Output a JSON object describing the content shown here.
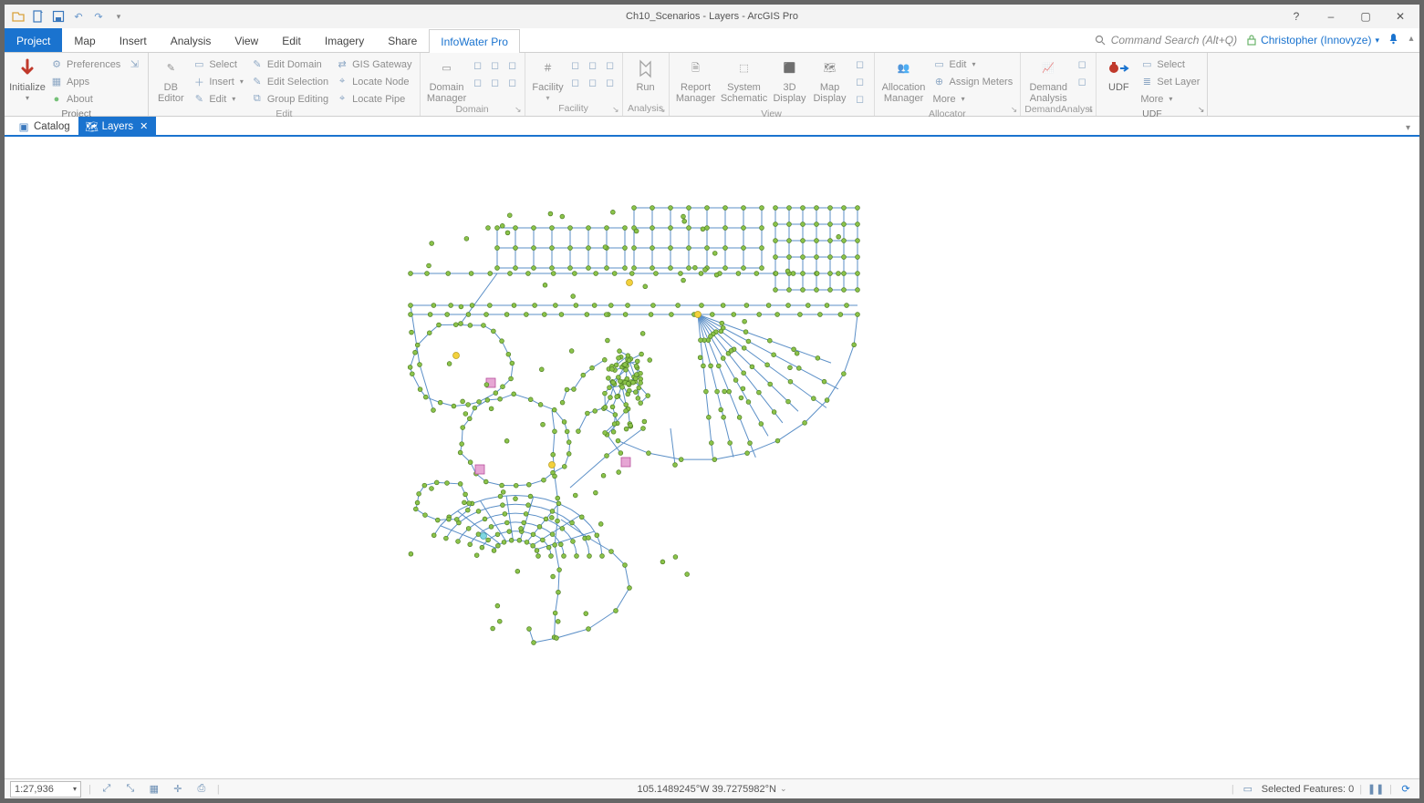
{
  "title": "Ch10_Scenarios - Layers - ArcGIS Pro",
  "qat": {
    "tips": [
      "open",
      "new",
      "save",
      "undo",
      "redo",
      "customize"
    ]
  },
  "sys": {
    "help": "?",
    "min": "–",
    "max": "▢",
    "close": "✕"
  },
  "search": {
    "placeholder": "Command Search (Alt+Q)"
  },
  "user": {
    "name": "Christopher (Innovyze)"
  },
  "tabs": {
    "project": "Project",
    "items": [
      "Map",
      "Insert",
      "Analysis",
      "View",
      "Edit",
      "Imagery",
      "Share",
      "InfoWater Pro"
    ],
    "active": "InfoWater Pro"
  },
  "ribbon": {
    "project": {
      "label": "Project",
      "initialize": "Initialize",
      "preferences": "Preferences",
      "apps": "Apps",
      "about": "About"
    },
    "edit": {
      "label": "Edit",
      "dbeditor": "DB\nEditor",
      "select": "Select",
      "insert": "Insert",
      "edit": "Edit",
      "editdomain": "Edit Domain",
      "editselection": "Edit Selection",
      "groupediting": "Group Editing",
      "gisgateway": "GIS Gateway",
      "locatenode": "Locate Node",
      "locatepipe": "Locate Pipe"
    },
    "domain": {
      "label": "Domain",
      "mgr": "Domain\nManager"
    },
    "facility": {
      "label": "Facility",
      "btn": "Facility"
    },
    "analysis": {
      "label": "Analysis",
      "run": "Run"
    },
    "view": {
      "label": "View",
      "report": "Report\nManager",
      "schem": "System\nSchematic",
      "d3": "3D\nDisplay",
      "mapd": "Map\nDisplay"
    },
    "allocator": {
      "label": "Allocator",
      "alloc": "Allocation\nManager",
      "edit": "Edit",
      "assign": "Assign Meters",
      "more": "More"
    },
    "demand": {
      "label": "DemandAnalyst",
      "btn": "Demand\nAnalysis"
    },
    "udf": {
      "label": "UDF",
      "btn": "UDF",
      "select": "Select",
      "setlayer": "Set Layer",
      "more": "More"
    }
  },
  "viewtabs": {
    "catalog": "Catalog",
    "layers": "Layers"
  },
  "status": {
    "scale": "1:27,936",
    "coords": "105.1489245°W 39.7275982°N",
    "selected": "Selected Features: 0"
  }
}
